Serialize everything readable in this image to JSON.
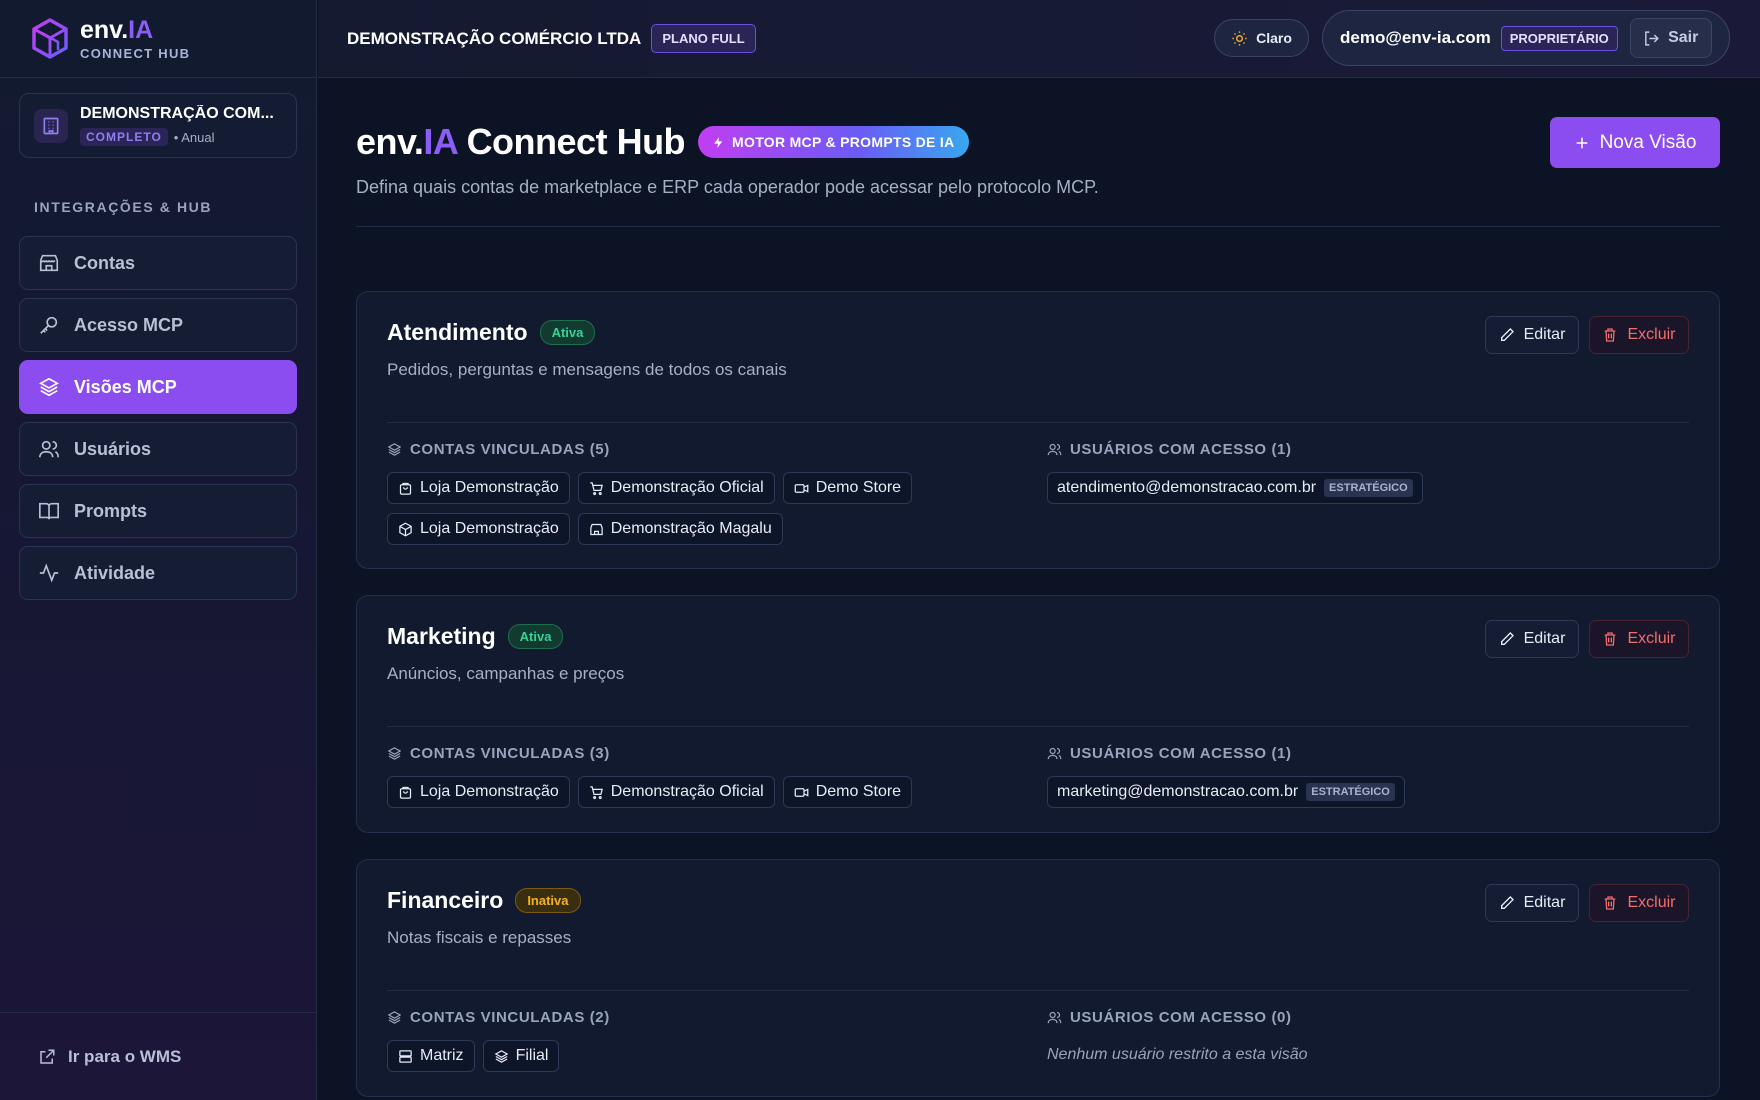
{
  "sidebar": {
    "brand_name": "env.",
    "brand_ia": "IA",
    "brand_sub": "CONNECT HUB",
    "company_name": "DEMONSTRAÇÃO COM...",
    "company_plan_tag": "COMPLETO",
    "company_billing": "• Anual",
    "section_label": "INTEGRAÇÕES & HUB",
    "nav": [
      {
        "label": "Contas",
        "icon": "store-icon"
      },
      {
        "label": "Acesso MCP",
        "icon": "key-icon"
      },
      {
        "label": "Visões MCP",
        "icon": "layers-icon",
        "active": true
      },
      {
        "label": "Usuários",
        "icon": "users-icon"
      },
      {
        "label": "Prompts",
        "icon": "book-icon"
      },
      {
        "label": "Atividade",
        "icon": "activity-icon"
      }
    ],
    "footer_link": "Ir para o WMS"
  },
  "topbar": {
    "company": "DEMONSTRAÇÃO COMÉRCIO LTDA",
    "plan": "PLANO FULL",
    "theme_label": "Claro",
    "email": "demo@env-ia.com",
    "role": "PROPRIETÁRIO",
    "logout": "Sair"
  },
  "page": {
    "title_env": "env.",
    "title_ia": "IA",
    "title_rest": "Connect Hub",
    "badge": "MOTOR MCP & PROMPTS DE IA",
    "description": "Defina quais contas de marketplace e ERP cada operador pode acessar pelo protocolo MCP.",
    "new_button": "Nova Visão"
  },
  "labels": {
    "edit": "Editar",
    "delete": "Excluir"
  },
  "views": [
    {
      "name": "Atendimento",
      "status": "Ativa",
      "description": "Pedidos, perguntas e mensagens de todos os canais",
      "accounts_header": "CONTAS VINCULADAS (5)",
      "accounts": [
        {
          "label": "Loja Demonstração",
          "icon": "shopping-bag-icon"
        },
        {
          "label": "Demonstração Oficial",
          "icon": "cart-icon"
        },
        {
          "label": "Demo Store",
          "icon": "video-icon"
        },
        {
          "label": "Loja Demonstração",
          "icon": "package-icon"
        },
        {
          "label": "Demonstração Magalu",
          "icon": "store-icon"
        }
      ],
      "users_header": "USUÁRIOS COM ACESSO (1)",
      "users": [
        {
          "email": "atendimento@demonstracao.com.br",
          "level": "ESTRATÉGICO"
        }
      ]
    },
    {
      "name": "Marketing",
      "status": "Ativa",
      "description": "Anúncios, campanhas e preços",
      "accounts_header": "CONTAS VINCULADAS (3)",
      "accounts": [
        {
          "label": "Loja Demonstração",
          "icon": "shopping-bag-icon"
        },
        {
          "label": "Demonstração Oficial",
          "icon": "cart-icon"
        },
        {
          "label": "Demo Store",
          "icon": "video-icon"
        }
      ],
      "users_header": "USUÁRIOS COM ACESSO (1)",
      "users": [
        {
          "email": "marketing@demonstracao.com.br",
          "level": "ESTRATÉGICO"
        }
      ]
    },
    {
      "name": "Financeiro",
      "status": "Inativa",
      "description": "Notas fiscais e repasses",
      "accounts_header": "CONTAS VINCULADAS (2)",
      "accounts": [
        {
          "label": "Matriz",
          "icon": "server-icon"
        },
        {
          "label": "Filial",
          "icon": "layers-icon"
        }
      ],
      "users_header": "USUÁRIOS COM ACESSO (0)",
      "users": [],
      "empty_users": "Nenhum usuário restrito a esta visão"
    }
  ]
}
